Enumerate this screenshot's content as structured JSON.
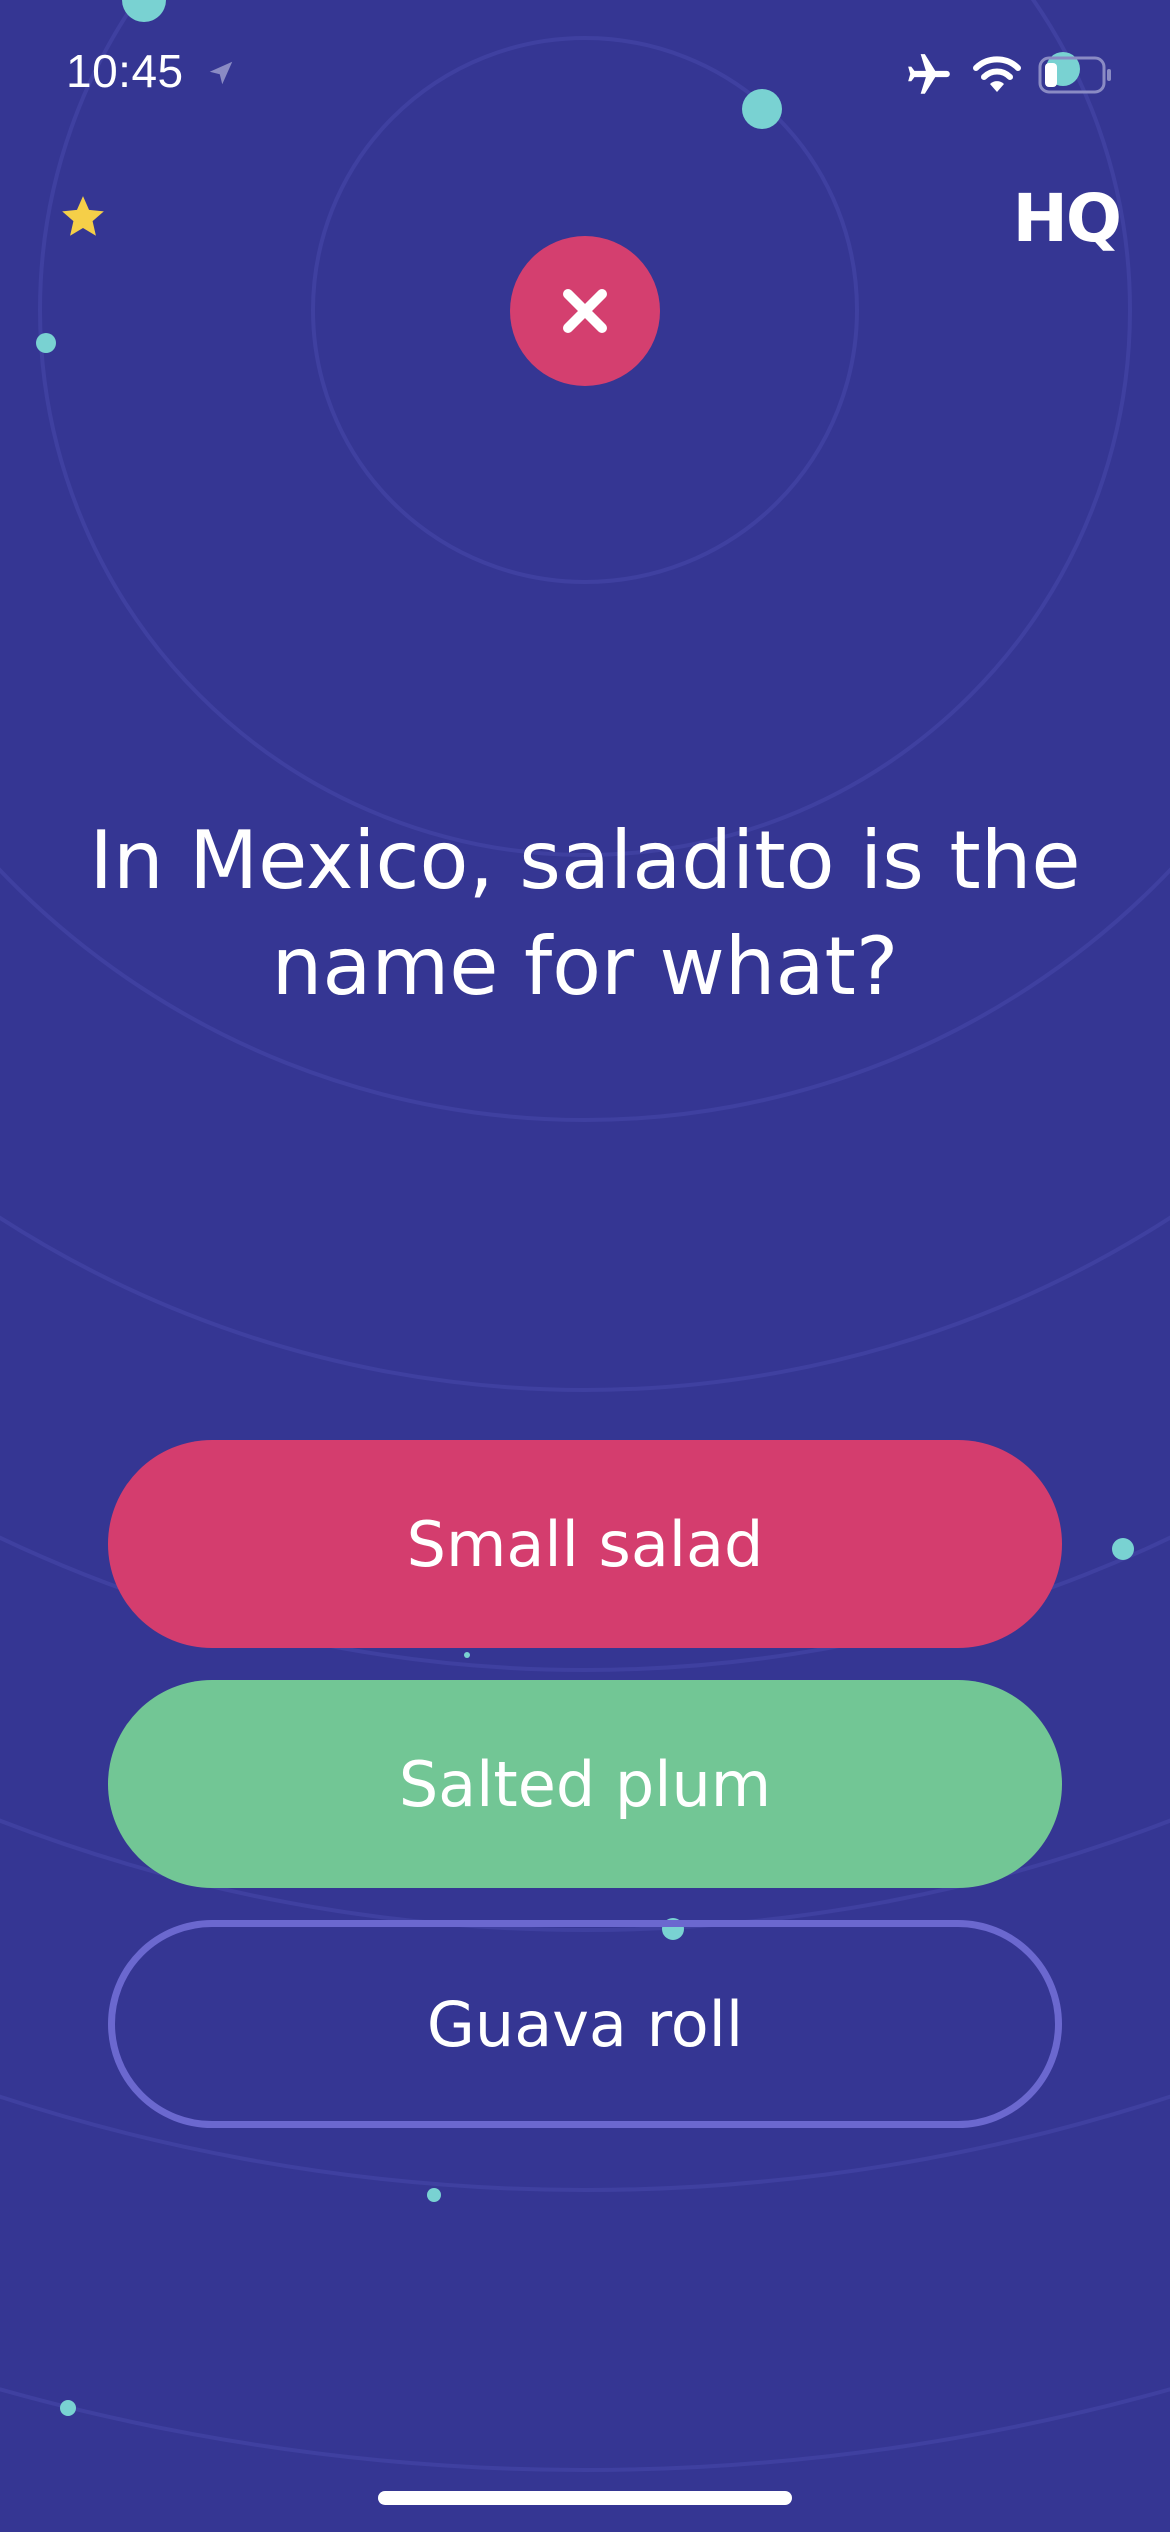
{
  "status_bar": {
    "time": "10:45",
    "icons": [
      "location-arrow-icon",
      "airplane-icon",
      "wifi-icon",
      "battery-icon"
    ]
  },
  "header": {
    "star_icon": "star-icon",
    "logo_text": "HQ"
  },
  "result": {
    "icon": "close-x-icon",
    "color": "#D43F6F"
  },
  "question": {
    "text": "In Mexico, saladito is the name for what?"
  },
  "answers": [
    {
      "label": "Small salad",
      "state": "wrong",
      "color": "#D43D6E"
    },
    {
      "label": "Salted plum",
      "state": "correct",
      "color": "#72C695"
    },
    {
      "label": "Guava roll",
      "state": "unselected",
      "color": "#6B68CF"
    }
  ],
  "colors": {
    "background": "#353693",
    "accent_dot": "#79D2D2",
    "star": "#F5CF48"
  }
}
